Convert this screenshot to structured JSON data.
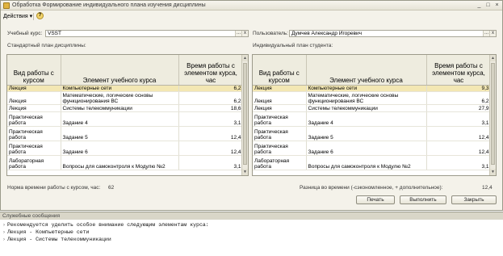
{
  "window": {
    "title": "Обработка  Формирование индивидуального плана изучения дисциплины",
    "buttons": {
      "minimize": "_",
      "maximize": "□",
      "close": "×"
    }
  },
  "toolbar": {
    "actions_label": "Действия ▾",
    "help_label": "?"
  },
  "form": {
    "course_label": "Учебный курс:",
    "course_value": "VSST",
    "user_label": "Пользователь:",
    "user_value": "Думчев Александр Игоревич",
    "select_btn": "...",
    "clear_btn": "x",
    "standard_plan_label": "Стандартный план дисциплины:",
    "individual_plan_label": "Индивидуальный план студента:"
  },
  "columns": [
    "Вид работы с курсом",
    "Элемент учебного курса",
    "Время работы с элементом курса, час"
  ],
  "standard_rows": [
    {
      "type": "Лекция",
      "element": "Компьютерные сети",
      "hours": "6,2"
    },
    {
      "type": "Лекция",
      "element": "Математические, логические основы функционирования ВС",
      "hours": "6,2"
    },
    {
      "type": "Лекция",
      "element": "Системы телекоммуникации",
      "hours": "18,6"
    },
    {
      "type": "Практическая работа",
      "element": "Задание 4",
      "hours": "3,1"
    },
    {
      "type": "Практическая работа",
      "element": "Задание 5",
      "hours": "12,4"
    },
    {
      "type": "Практическая работа",
      "element": "Задание 6",
      "hours": "12,4"
    },
    {
      "type": "Лабораторная работа",
      "element": "Вопросы для самоконтроля к Модулю №2",
      "hours": "3,1"
    }
  ],
  "individual_rows": [
    {
      "type": "Лекция",
      "element": "Компьютерные сети",
      "hours": "9,3"
    },
    {
      "type": "Лекция",
      "element": "Математические, логические основы функционирования ВС",
      "hours": "6,2"
    },
    {
      "type": "Лекция",
      "element": "Системы телекоммуникации",
      "hours": "27,9"
    },
    {
      "type": "Практическая работа",
      "element": "Задание 4",
      "hours": "3,1"
    },
    {
      "type": "Практическая работа",
      "element": "Задание 5",
      "hours": "12,4"
    },
    {
      "type": "Практическая работа",
      "element": "Задание 6",
      "hours": "12,4"
    },
    {
      "type": "Лабораторная работа",
      "element": "Вопросы для самоконтроля к Модулю №2",
      "hours": "3,1"
    }
  ],
  "footer": {
    "norm_label": "Норма времени работы с курсом, час:",
    "norm_value": "62",
    "diff_label": "Разница во времени (-сэкономленное, + дополнительное):",
    "diff_value": "12,4",
    "print_btn": "Печать",
    "execute_btn": "Выполнить",
    "close_btn": "Закрыть"
  },
  "messages": {
    "title": "Служебные сообщения",
    "lines": [
      "Рекомендуется уделить особое внимание следующим элементам курса:",
      "Лекция - Компьютерные сети",
      "Лекция - Системы телекоммуникации"
    ]
  }
}
